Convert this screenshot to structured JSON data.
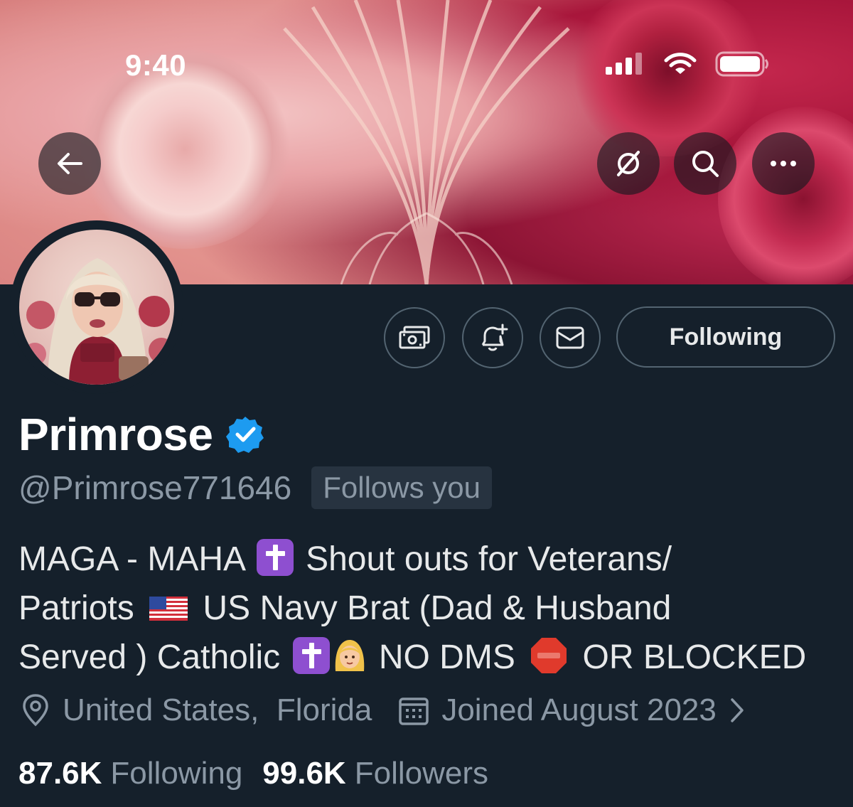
{
  "status_bar": {
    "time": "9:40"
  },
  "banner": {
    "back_icon": "arrow-left-icon",
    "buttons": [
      "dismiss-icon",
      "search-icon",
      "more-icon"
    ]
  },
  "actions": {
    "icons": [
      "subscribe-money-icon",
      "notifications-add-icon",
      "message-icon"
    ],
    "following_label": "Following"
  },
  "profile": {
    "display_name": "Primrose",
    "verified": true,
    "handle": "@Primrose771646",
    "follows_you": "Follows you",
    "bio": {
      "part1": "MAGA - MAHA",
      "part2": "Shout outs for Veterans/",
      "part3": "Patriots",
      "part4": "US Navy Brat (Dad & Husband",
      "part5": "Served ) Catholic",
      "part6": "NO DMS",
      "part7": "OR BLOCKED"
    },
    "location": "United States,  Florida",
    "joined": "Joined August 2023",
    "following_count": "87.6K",
    "following_label": "Following",
    "followers_count": "99.6K",
    "followers_label": "Followers"
  },
  "colors": {
    "background": "#15202b",
    "muted": "#8b98a5",
    "verified": "#1d9bf0"
  }
}
